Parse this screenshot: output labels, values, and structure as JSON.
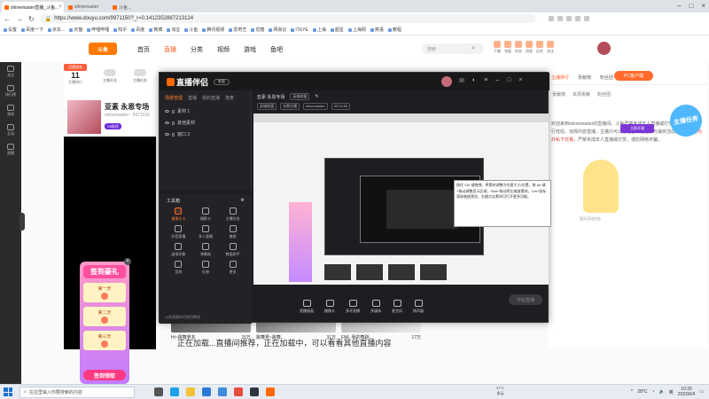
{
  "browser": {
    "tabs": [
      {
        "label": "shinemaster直播_斗鱼...",
        "active": true
      },
      {
        "label": "shinemaster",
        "active": false
      },
      {
        "label": "斗鱼...",
        "active": false
      }
    ],
    "url": "https://www.douyu.com/9971150?_r=0.1412352887213124",
    "bookmarks": [
      "设置",
      "百度一下",
      "京东...",
      "天猫",
      "哔哩哔哩",
      "知乎",
      "百度",
      "微博",
      "淘宝",
      "斗鱼",
      "腾讯视频",
      "爱奇艺",
      "优酷",
      "网易云",
      "ITEYE",
      "上海",
      "超星",
      "上海网",
      "英语",
      "教程"
    ]
  },
  "douyu": {
    "logo": "斗鱼",
    "nav": [
      "首页",
      "直播",
      "分类",
      "视频",
      "游戏",
      "鱼吧"
    ],
    "active_nav": "直播",
    "search_placeholder": "搜索",
    "top_icons": [
      "下载",
      "充值",
      "任务",
      "消息",
      "历史",
      "关注"
    ],
    "rank_badge": "月榜排名",
    "rank_num": "11",
    "rank_label": "主播排行",
    "head_btns": [
      "主播开关",
      "主播任务"
    ],
    "streamer_name": "亚素 永恩专场",
    "streamer_sub": "shinemaster · 9971150",
    "streamer_pill": "V6陪伴",
    "right_tabs": [
      "主播排行",
      "贡献榜",
      "粉丝团"
    ],
    "right_text_1": "欢迎来到shinemaster的直播间。斗鱼严禁未成年人直播或打赏，严禁主播进行低俗、违规内容直播，主播只可以通过合法途径参与抽奖活动。",
    "right_text_hl": "禁止平台内外私下交易",
    "right_text_2": "，严禁未成年人直播或打赏，谨防网络诈骗。",
    "mascot_caption": "暂无活动任务",
    "pc_btn": "PC客户端",
    "task_badge": "主播任务",
    "side_labels": [
      "贡献榜",
      "本周贡献",
      "粉丝团"
    ],
    "right_btn": "立即开通",
    "cards": [
      {
        "title": "Hi~跳舞男友",
        "count": "15万"
      },
      {
        "title": "跳舞男~跳舞...",
        "count": "31万"
      },
      {
        "title": "FML·我的舞蹈...",
        "count": "17万"
      }
    ],
    "bottom_text": "正在加载...直播间推荐，正在加载中，可以看看其他直播内容"
  },
  "gift": {
    "title": "签到豪礼",
    "days": [
      "第一天",
      "第二天",
      "第三天"
    ],
    "claim": "签到领取"
  },
  "rail": [
    "关注",
    "排行榜",
    "游戏",
    "互动",
    "直播"
  ],
  "app": {
    "name": "直播伴侣",
    "pill": "新版",
    "scene_tabs": [
      "场景管理",
      "直播",
      "我的直播",
      "连麦"
    ],
    "scenes": [
      "素材 1",
      "其他素材",
      "窗口 2"
    ],
    "tools_title": "工具箱",
    "tools": [
      {
        "label": "摄像头卡",
        "active": true
      },
      {
        "label": "摄影卡",
        "active": false
      },
      {
        "label": "主播任务",
        "active": false
      },
      {
        "label": "抖音直播",
        "active": false
      },
      {
        "label": "多人直播",
        "active": false
      },
      {
        "label": "美颜",
        "active": false
      },
      {
        "label": "虚拟形象",
        "active": false
      },
      {
        "label": "弹幕助",
        "active": false
      },
      {
        "label": "数据助手",
        "active": false
      },
      {
        "label": "音效",
        "active": false
      },
      {
        "label": "礼物",
        "active": false
      },
      {
        "label": "更多",
        "active": false
      }
    ],
    "tools_foot": "斗鱼直播伴侣使用教程",
    "room_title": "亚素 永恩专场",
    "room_tag": "英雄联盟",
    "room_tags": [
      "英雄联盟",
      "长期主播",
      "shinemaster",
      "9971150"
    ],
    "tooltip": "按住 Ctrl 键拖拽，将素材调整为任意大小/位置，按 Alt 键+拖动调整显示区域，Shift+拖动等比缩放素材。Ctrl+鼠标滚轮缩放预览，右键点击素材可打开更多功能。",
    "bottom_tools": [
      "直播画面",
      "摄像头",
      "多开直播",
      "多媒体",
      "麦克风",
      "扬声器"
    ],
    "start_btn": "开始直播"
  },
  "taskbar": {
    "search_placeholder": "在这里输入你要搜索的内容",
    "weather_temp": "27°C",
    "weather_desc": "多云",
    "tray_temp": "28°C",
    "tray_lang": "英",
    "time": "10:25",
    "date": "2022/6/4"
  },
  "colors": {
    "brand": "#ff5d23",
    "app_bg": "#1e1e22",
    "accent_purple": "#6d2bd9"
  }
}
